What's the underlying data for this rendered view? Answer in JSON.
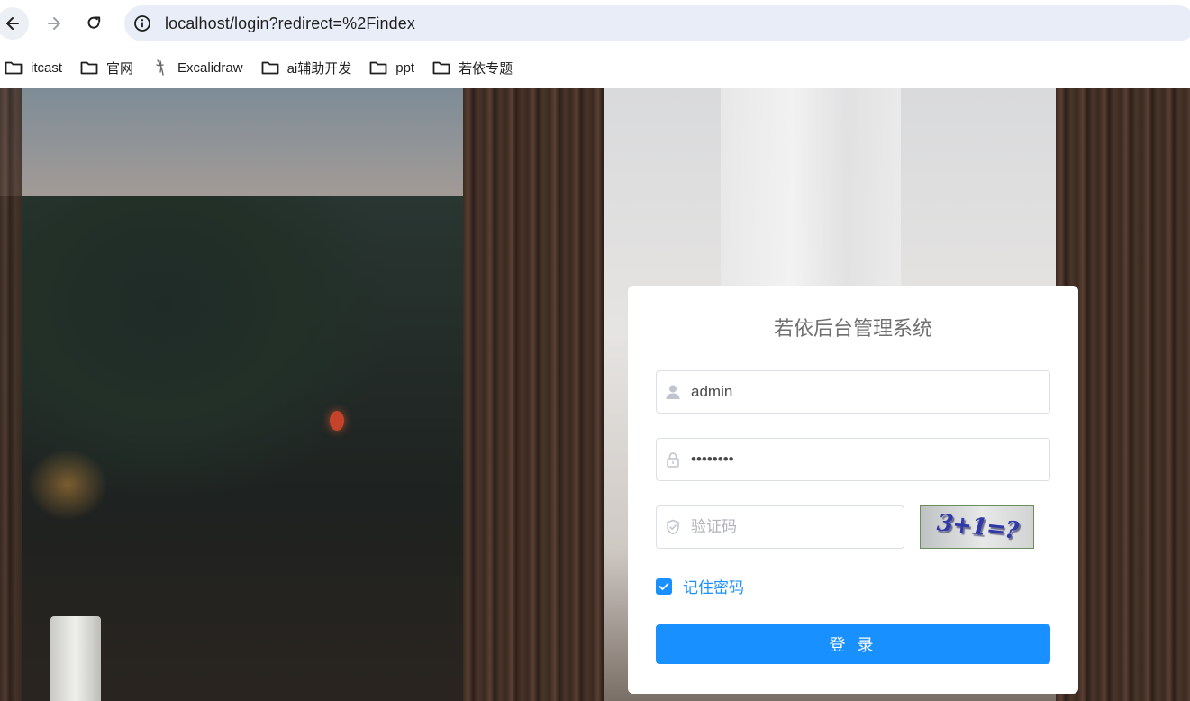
{
  "browser": {
    "url": "localhost/login?redirect=%2Findex",
    "bookmarks": [
      {
        "label": "itcast",
        "icon": "folder-icon"
      },
      {
        "label": "官网",
        "icon": "folder-icon"
      },
      {
        "label": "Excalidraw",
        "icon": "excalidraw-icon"
      },
      {
        "label": "ai辅助开发",
        "icon": "folder-icon"
      },
      {
        "label": "ppt",
        "icon": "folder-icon"
      },
      {
        "label": "若依专题",
        "icon": "folder-icon"
      }
    ]
  },
  "login": {
    "title": "若依后台管理系统",
    "username_value": "admin",
    "password_value": "password",
    "code_placeholder": "验证码",
    "captcha_text": "3+1=?",
    "remember_label": "记住密码",
    "remember_checked": true,
    "submit_label": "登 录"
  },
  "colors": {
    "primary": "#1890ff",
    "card_bg": "#ffffff",
    "title_text": "#707070"
  }
}
